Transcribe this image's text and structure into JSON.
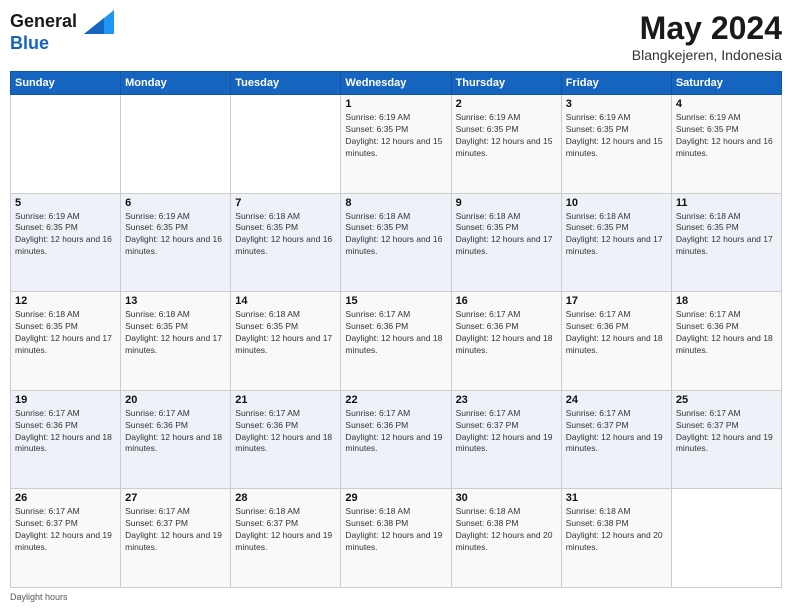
{
  "logo": {
    "line1": "General",
    "line2": "Blue"
  },
  "title": "May 2024",
  "location": "Blangkejeren, Indonesia",
  "days_of_week": [
    "Sunday",
    "Monday",
    "Tuesday",
    "Wednesday",
    "Thursday",
    "Friday",
    "Saturday"
  ],
  "weeks": [
    [
      {
        "day": "",
        "info": ""
      },
      {
        "day": "",
        "info": ""
      },
      {
        "day": "",
        "info": ""
      },
      {
        "day": "1",
        "info": "Sunrise: 6:19 AM\nSunset: 6:35 PM\nDaylight: 12 hours and 15 minutes."
      },
      {
        "day": "2",
        "info": "Sunrise: 6:19 AM\nSunset: 6:35 PM\nDaylight: 12 hours and 15 minutes."
      },
      {
        "day": "3",
        "info": "Sunrise: 6:19 AM\nSunset: 6:35 PM\nDaylight: 12 hours and 15 minutes."
      },
      {
        "day": "4",
        "info": "Sunrise: 6:19 AM\nSunset: 6:35 PM\nDaylight: 12 hours and 16 minutes."
      }
    ],
    [
      {
        "day": "5",
        "info": "Sunrise: 6:19 AM\nSunset: 6:35 PM\nDaylight: 12 hours and 16 minutes."
      },
      {
        "day": "6",
        "info": "Sunrise: 6:19 AM\nSunset: 6:35 PM\nDaylight: 12 hours and 16 minutes."
      },
      {
        "day": "7",
        "info": "Sunrise: 6:18 AM\nSunset: 6:35 PM\nDaylight: 12 hours and 16 minutes."
      },
      {
        "day": "8",
        "info": "Sunrise: 6:18 AM\nSunset: 6:35 PM\nDaylight: 12 hours and 16 minutes."
      },
      {
        "day": "9",
        "info": "Sunrise: 6:18 AM\nSunset: 6:35 PM\nDaylight: 12 hours and 17 minutes."
      },
      {
        "day": "10",
        "info": "Sunrise: 6:18 AM\nSunset: 6:35 PM\nDaylight: 12 hours and 17 minutes."
      },
      {
        "day": "11",
        "info": "Sunrise: 6:18 AM\nSunset: 6:35 PM\nDaylight: 12 hours and 17 minutes."
      }
    ],
    [
      {
        "day": "12",
        "info": "Sunrise: 6:18 AM\nSunset: 6:35 PM\nDaylight: 12 hours and 17 minutes."
      },
      {
        "day": "13",
        "info": "Sunrise: 6:18 AM\nSunset: 6:35 PM\nDaylight: 12 hours and 17 minutes."
      },
      {
        "day": "14",
        "info": "Sunrise: 6:18 AM\nSunset: 6:35 PM\nDaylight: 12 hours and 17 minutes."
      },
      {
        "day": "15",
        "info": "Sunrise: 6:17 AM\nSunset: 6:36 PM\nDaylight: 12 hours and 18 minutes."
      },
      {
        "day": "16",
        "info": "Sunrise: 6:17 AM\nSunset: 6:36 PM\nDaylight: 12 hours and 18 minutes."
      },
      {
        "day": "17",
        "info": "Sunrise: 6:17 AM\nSunset: 6:36 PM\nDaylight: 12 hours and 18 minutes."
      },
      {
        "day": "18",
        "info": "Sunrise: 6:17 AM\nSunset: 6:36 PM\nDaylight: 12 hours and 18 minutes."
      }
    ],
    [
      {
        "day": "19",
        "info": "Sunrise: 6:17 AM\nSunset: 6:36 PM\nDaylight: 12 hours and 18 minutes."
      },
      {
        "day": "20",
        "info": "Sunrise: 6:17 AM\nSunset: 6:36 PM\nDaylight: 12 hours and 18 minutes."
      },
      {
        "day": "21",
        "info": "Sunrise: 6:17 AM\nSunset: 6:36 PM\nDaylight: 12 hours and 18 minutes."
      },
      {
        "day": "22",
        "info": "Sunrise: 6:17 AM\nSunset: 6:36 PM\nDaylight: 12 hours and 19 minutes."
      },
      {
        "day": "23",
        "info": "Sunrise: 6:17 AM\nSunset: 6:37 PM\nDaylight: 12 hours and 19 minutes."
      },
      {
        "day": "24",
        "info": "Sunrise: 6:17 AM\nSunset: 6:37 PM\nDaylight: 12 hours and 19 minutes."
      },
      {
        "day": "25",
        "info": "Sunrise: 6:17 AM\nSunset: 6:37 PM\nDaylight: 12 hours and 19 minutes."
      }
    ],
    [
      {
        "day": "26",
        "info": "Sunrise: 6:17 AM\nSunset: 6:37 PM\nDaylight: 12 hours and 19 minutes."
      },
      {
        "day": "27",
        "info": "Sunrise: 6:17 AM\nSunset: 6:37 PM\nDaylight: 12 hours and 19 minutes."
      },
      {
        "day": "28",
        "info": "Sunrise: 6:18 AM\nSunset: 6:37 PM\nDaylight: 12 hours and 19 minutes."
      },
      {
        "day": "29",
        "info": "Sunrise: 6:18 AM\nSunset: 6:38 PM\nDaylight: 12 hours and 19 minutes."
      },
      {
        "day": "30",
        "info": "Sunrise: 6:18 AM\nSunset: 6:38 PM\nDaylight: 12 hours and 20 minutes."
      },
      {
        "day": "31",
        "info": "Sunrise: 6:18 AM\nSunset: 6:38 PM\nDaylight: 12 hours and 20 minutes."
      },
      {
        "day": "",
        "info": ""
      }
    ]
  ],
  "footer": {
    "daylight_label": "Daylight hours"
  }
}
